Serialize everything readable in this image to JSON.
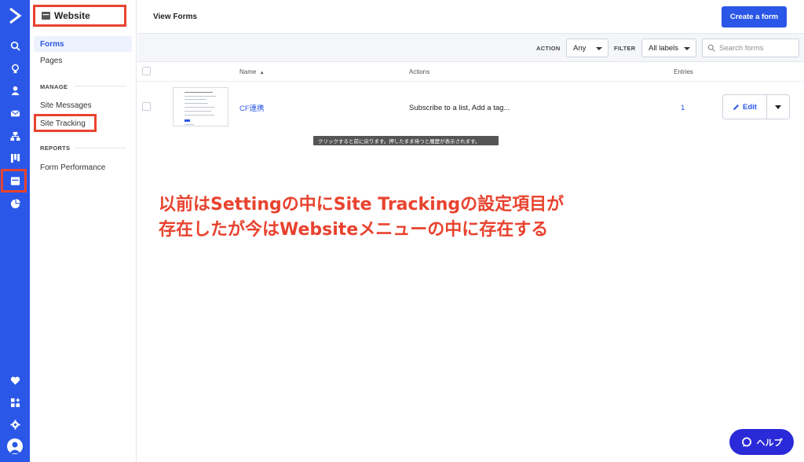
{
  "rail": {
    "icons": [
      "search-icon",
      "lightbulb-icon",
      "contacts-icon",
      "campaigns-icon",
      "automations-icon",
      "deals-icon",
      "website-icon",
      "reports-icon",
      "heart-icon",
      "apps-icon",
      "settings-icon",
      "avatar-icon"
    ],
    "active": "website-icon",
    "color": "#2a57e7"
  },
  "sidebar": {
    "title": "Website",
    "items": [
      {
        "label": "Forms",
        "active": true
      },
      {
        "label": "Pages"
      }
    ],
    "manage_label": "MANAGE",
    "manage_items": [
      {
        "label": "Site Messages"
      },
      {
        "label": "Site Tracking"
      }
    ],
    "reports_label": "REPORTS",
    "reports_items": [
      {
        "label": "Form Performance"
      }
    ]
  },
  "header": {
    "title": "View Forms",
    "create_button": "Create a form"
  },
  "filters": {
    "action_label": "ACTION",
    "action_value": "Any",
    "filter_label": "FILTER",
    "filter_value": "All labels",
    "search_placeholder": "Search forms"
  },
  "table": {
    "columns": [
      "Name",
      "Actions",
      "Entries"
    ],
    "rows": [
      {
        "name": "CF連携",
        "actions": "Subscribe to a list, Add a tag...",
        "entries": "1",
        "edit_label": "Edit"
      }
    ]
  },
  "tooltip": "クリックすると前に戻ります。押したまま待つと履歴が表示されます。",
  "annotation": {
    "line1": "以前はSettingの中にSite Trackingの設定項目が",
    "line2": "存在したが今はWebsiteメニューの中に存在する",
    "color": "#e8432f"
  },
  "help_button": "ヘルプ",
  "colors": {
    "accent": "#2a57e7",
    "highlight": "#e8432f",
    "help": "#2a2ad8"
  }
}
